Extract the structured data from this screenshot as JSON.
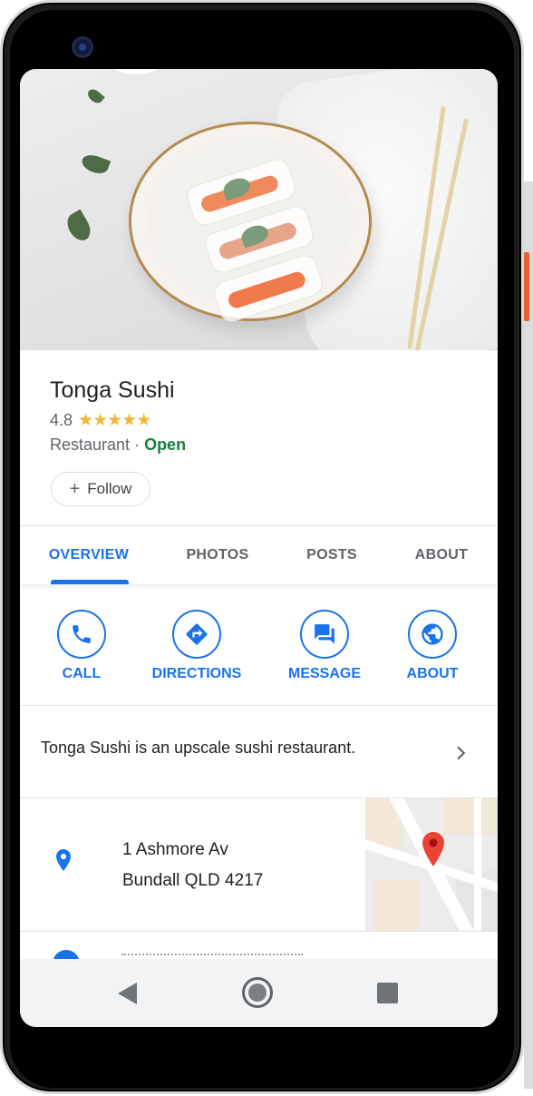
{
  "business": {
    "name": "Tonga Sushi",
    "rating": "4.8",
    "stars": "★★★★★",
    "category": "Restaurant",
    "separator": " · ",
    "status": "Open",
    "follow_label": "Follow"
  },
  "tabs": [
    {
      "label": "OVERVIEW",
      "active": true
    },
    {
      "label": "PHOTOS",
      "active": false
    },
    {
      "label": "POSTS",
      "active": false
    },
    {
      "label": "ABOUT",
      "active": false
    }
  ],
  "actions": [
    {
      "label": "CALL",
      "icon": "phone-icon"
    },
    {
      "label": "DIRECTIONS",
      "icon": "directions-icon"
    },
    {
      "label": "MESSAGE",
      "icon": "message-icon"
    },
    {
      "label": "ABOUT",
      "icon": "globe-icon"
    }
  ],
  "description": "Tonga Sushi is an upscale sushi restaurant.",
  "address": {
    "line1": "1 Ashmore Av",
    "line2": "Bundall QLD 4217"
  },
  "colors": {
    "accent": "#1a73e8",
    "open_status": "#188038",
    "stars": "#f2b734",
    "map_pin": "#ea4335"
  },
  "icons": {
    "follow": "plus-icon",
    "description_more": "chevron-right-icon",
    "address": "location-pin-icon",
    "map_marker": "map-pin-icon",
    "nav_back": "back-triangle-icon",
    "nav_home": "home-circle-icon",
    "nav_recents": "recents-square-icon"
  }
}
